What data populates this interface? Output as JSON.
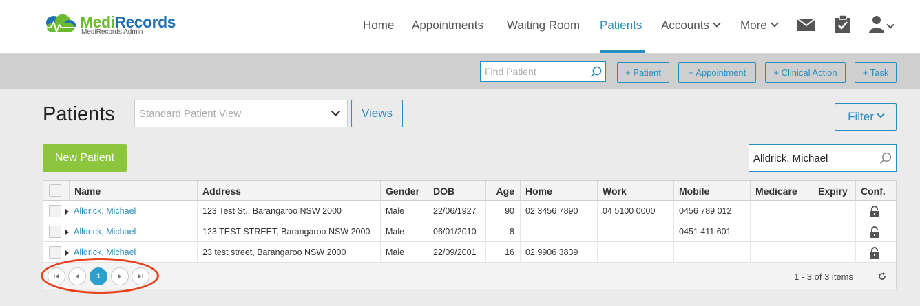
{
  "brand": {
    "name_part1": "Medi",
    "name_part2": "Records",
    "subtitle": "MediRecords Admin",
    "colors": {
      "green": "#6abb2f",
      "blue": "#1f6fb2"
    }
  },
  "nav": {
    "items": [
      {
        "label": "Home"
      },
      {
        "label": "Appointments"
      },
      {
        "label": "Waiting Room"
      },
      {
        "label": "Patients",
        "active": true
      },
      {
        "label": "Accounts"
      },
      {
        "label": "More"
      }
    ],
    "icons": [
      "mail-icon",
      "clipboard-check-icon",
      "user-icon"
    ],
    "accent": "#2a8dc0"
  },
  "toolbar": {
    "find_placeholder": "Find Patient",
    "buttons": [
      "+ Patient",
      "+ Appointment",
      "+ Clinical Action",
      "+ Task"
    ]
  },
  "main": {
    "title": "Patients",
    "view_placeholder": "Standard Patient View",
    "views_label": "Views",
    "filter_label": "Filter",
    "new_patient_label": "New Patient",
    "search_value": "Alldrick, Michael"
  },
  "grid": {
    "columns": [
      "Name",
      "Address",
      "Gender",
      "DOB",
      "Age",
      "Home",
      "Work",
      "Mobile",
      "Medicare",
      "Expiry",
      "Conf."
    ],
    "rows": [
      {
        "name": "Alldrick, Michael",
        "address": "123 Test St., Barangaroo NSW 2000",
        "gender": "Male",
        "dob": "22/06/1927",
        "age": "90",
        "home": "02 3456 7890",
        "work": "04 5100 0000",
        "mobile": "0456 789 012",
        "medicare": "",
        "expiry": ""
      },
      {
        "name": "Alldrick, Michael",
        "address": "123 TEST STREET, Barangaroo NSW 2000",
        "gender": "Male",
        "dob": "06/01/2010",
        "age": "8",
        "home": "",
        "work": "",
        "mobile": "0451 411 601",
        "medicare": "",
        "expiry": ""
      },
      {
        "name": "Alldrick, Michael",
        "address": "23 test street, Barangaroo NSW 2000",
        "gender": "Male",
        "dob": "22/09/2001",
        "age": "16",
        "home": "02 9906 3839",
        "work": "",
        "mobile": "",
        "medicare": "",
        "expiry": ""
      }
    ],
    "pager": {
      "current_page": "1",
      "summary": "1 - 3 of 3 items"
    },
    "annotation_color": "#e8411b"
  }
}
